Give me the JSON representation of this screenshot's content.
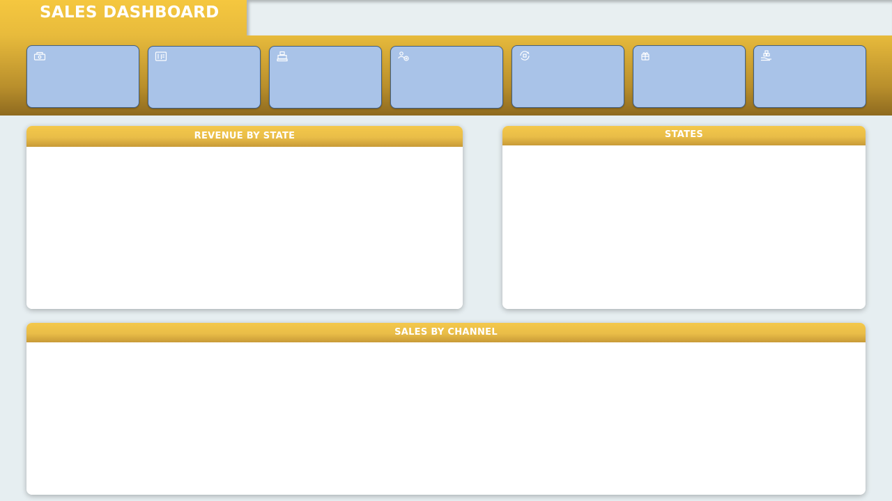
{
  "dashboard": {
    "title": "SALES DASHBOARD"
  },
  "filter_bar": {},
  "kpis": [
    {
      "icon": "cash-icon",
      "label": "",
      "value": ""
    },
    {
      "icon": "invoice-icon",
      "label": "",
      "value": ""
    },
    {
      "icon": "cash-register-icon",
      "label": "",
      "value": ""
    },
    {
      "icon": "customers-icon",
      "label": "",
      "value": ""
    },
    {
      "icon": "money-cycle-icon",
      "label": "",
      "value": ""
    },
    {
      "icon": "gift-box-icon",
      "label": "",
      "value": ""
    },
    {
      "icon": "hand-boxes-icon",
      "label": "",
      "value": ""
    }
  ],
  "panels": {
    "revenue_by_state": {
      "title": "REVENUE BY STATE"
    },
    "states": {
      "title": "STATES"
    },
    "sales_by_channel": {
      "title": "SALES BY CHANNEL"
    }
  },
  "colors": {
    "header_gold": "#f5c73f",
    "header_dark_gold": "#8e6a1f",
    "kpi_card_fill": "#a9c3e8",
    "kpi_card_border": "#3f5f86",
    "background": "#e6eef1",
    "panel_body": "#ffffff"
  }
}
